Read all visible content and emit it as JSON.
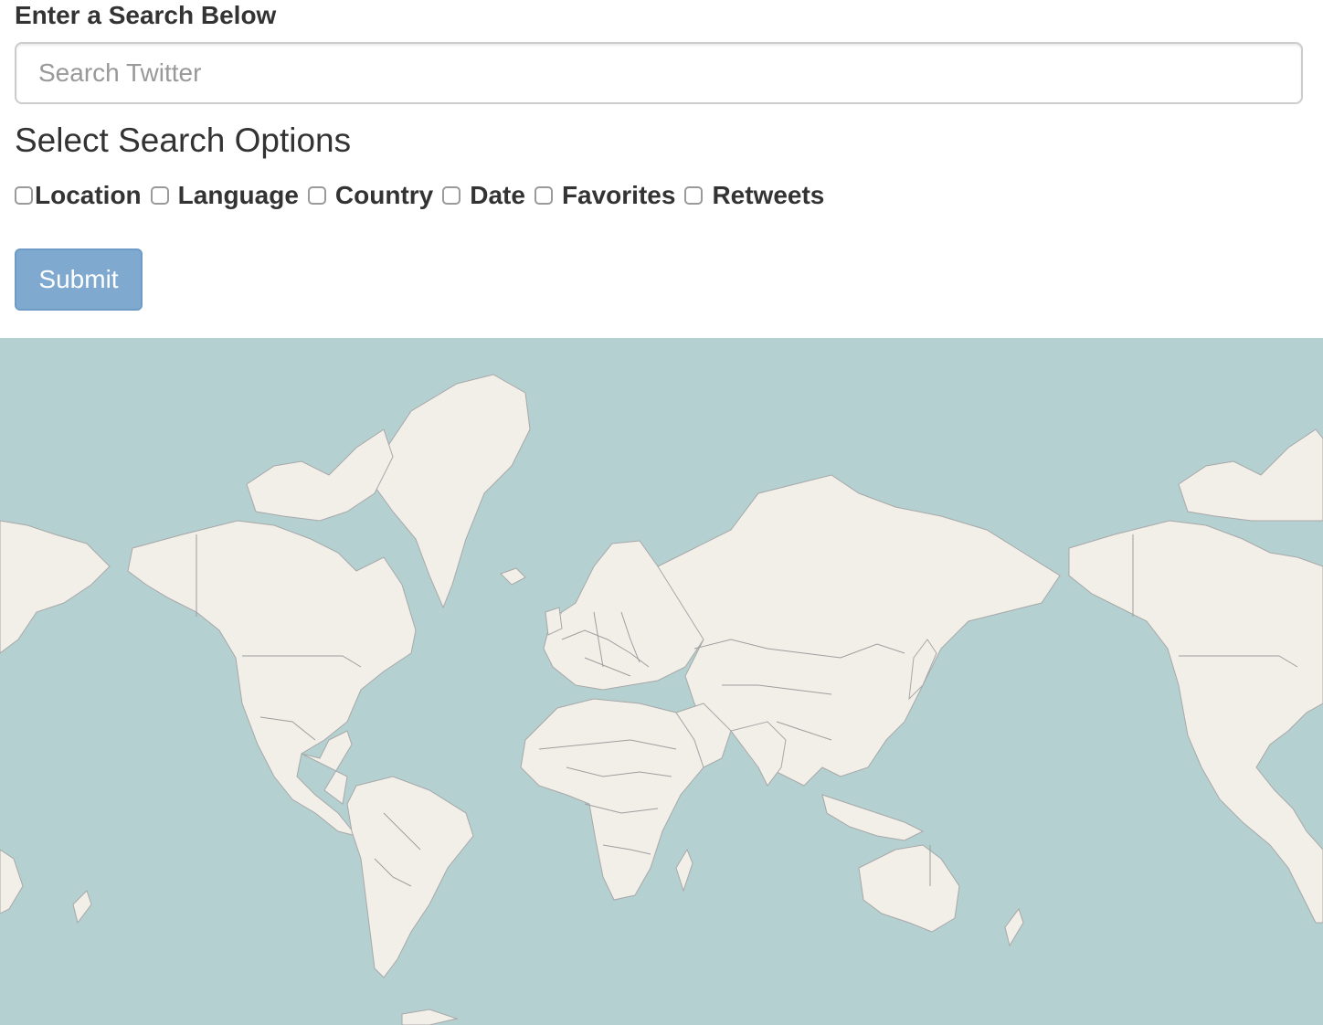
{
  "search": {
    "label": "Enter a Search Below",
    "placeholder": "Search Twitter",
    "value": ""
  },
  "options": {
    "heading": "Select Search Options",
    "items": [
      {
        "label": "Location",
        "checked": false
      },
      {
        "label": "Language",
        "checked": false
      },
      {
        "label": "Country",
        "checked": false
      },
      {
        "label": "Date",
        "checked": false
      },
      {
        "label": "Favorites",
        "checked": false
      },
      {
        "label": "Retweets",
        "checked": false
      }
    ]
  },
  "submit": {
    "label": "Submit"
  },
  "colors": {
    "accent": "#7fa9cf",
    "ocean": "#b5d0d0",
    "land": "#f2efe9",
    "border": "#9e9e9e",
    "text": "#333333"
  }
}
